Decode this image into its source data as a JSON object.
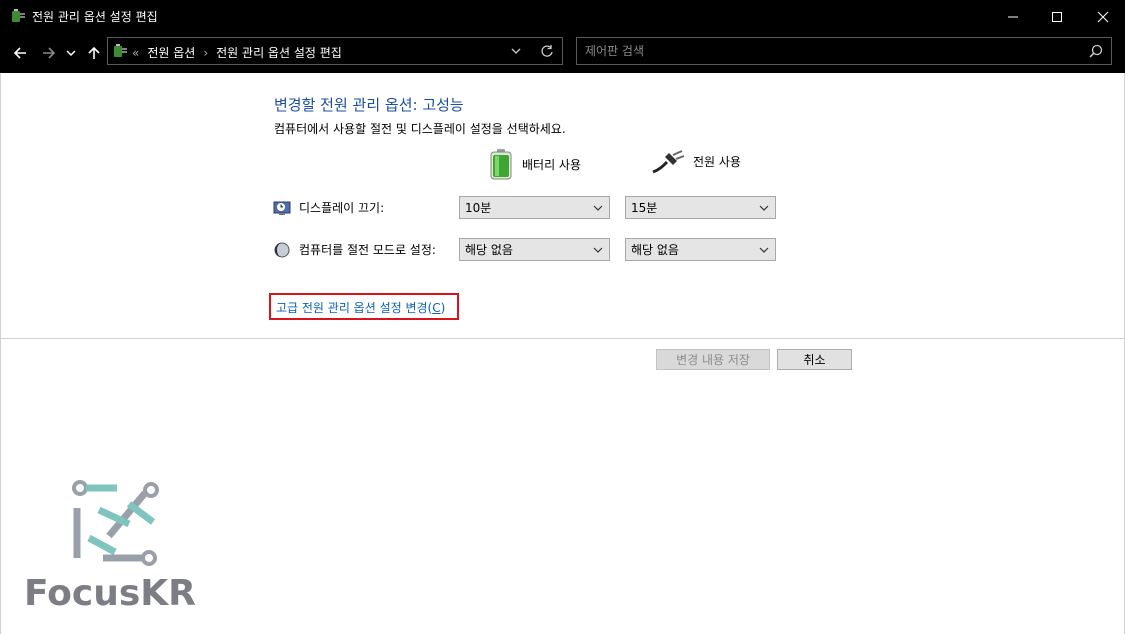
{
  "window": {
    "title": "전원 관리 옵션 설정 편집",
    "controls": {
      "minimize": "minimize",
      "maximize": "maximize",
      "close": "close"
    }
  },
  "navigation": {
    "breadcrumb_overflow": "«",
    "breadcrumbs": [
      "전원 옵션",
      "전원 관리 옵션 설정 편집"
    ],
    "breadcrumb_separator": "›",
    "search_placeholder": "제어판 검색"
  },
  "main": {
    "heading": "변경할 전원 관리 옵션: 고성능",
    "description": "컴퓨터에서 사용할 절전 및 디스플레이 설정을 선택하세요.",
    "columns": {
      "battery": "배터리 사용",
      "plugged_in": "전원 사용"
    },
    "settings": [
      {
        "label": "디스플레이 끄기:",
        "icon": "display-timer-icon",
        "battery_value": "10분",
        "plugged_value": "15분"
      },
      {
        "label": "컴퓨터를 절전 모드로 설정:",
        "icon": "sleep-moon-icon",
        "battery_value": "해당 없음",
        "plugged_value": "해당 없음"
      }
    ],
    "advanced_link": {
      "text": "고급 전원 관리 옵션 설정 변경(",
      "accel": "C",
      "close_paren": ")"
    },
    "buttons": {
      "save": "변경 내용 저장",
      "cancel": "취소"
    }
  },
  "watermark": {
    "text": "FocusKR"
  },
  "colors": {
    "titlebar_bg": "#000000",
    "heading": "#1b4f9c",
    "link": "#0a63b4",
    "highlight_border": "#d8141c"
  }
}
